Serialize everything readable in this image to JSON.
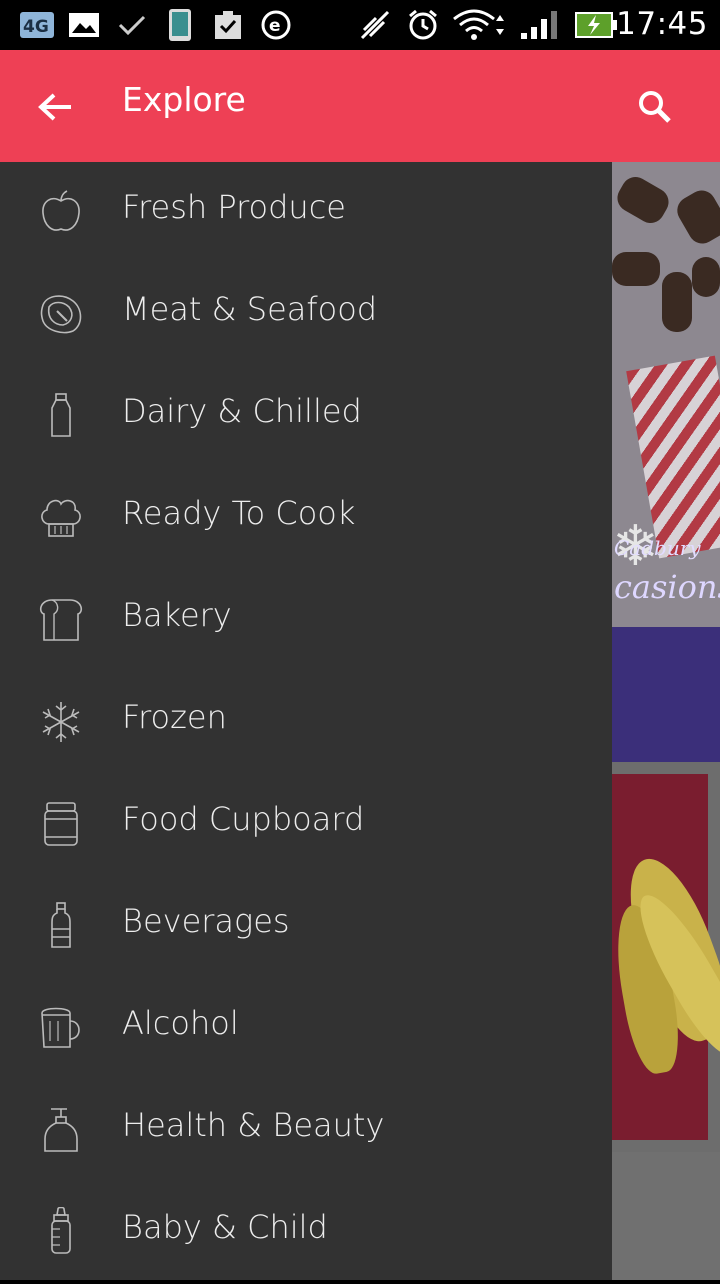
{
  "status_bar": {
    "time": "17:45",
    "icons": [
      "4g-lte-icon",
      "image-icon",
      "check-icon",
      "phone-icon",
      "clipboard-check-icon",
      "e-icon",
      "no-signal-icon",
      "alarm-icon",
      "wifi-icon",
      "cell-signal-icon",
      "battery-charging-icon"
    ]
  },
  "app_bar": {
    "title": "Explore",
    "back_icon": "arrow-back-icon",
    "search_icon": "search-icon",
    "color": "#ee4055"
  },
  "drawer": {
    "background": "#323232",
    "items": [
      {
        "label": "Fresh Produce",
        "icon": "apple-icon"
      },
      {
        "label": "Meat & Seafood",
        "icon": "steak-icon"
      },
      {
        "label": "Dairy & Chilled",
        "icon": "milk-bottle-icon"
      },
      {
        "label": "Ready To Cook",
        "icon": "chef-hat-icon"
      },
      {
        "label": "Bakery",
        "icon": "bread-icon"
      },
      {
        "label": "Frozen",
        "icon": "snowflake-icon"
      },
      {
        "label": "Food Cupboard",
        "icon": "jar-icon"
      },
      {
        "label": "Beverages",
        "icon": "bottle-icon"
      },
      {
        "label": "Alcohol",
        "icon": "beer-mug-icon"
      },
      {
        "label": "Health & Beauty",
        "icon": "lotion-pump-icon"
      },
      {
        "label": "Baby & Child",
        "icon": "baby-bottle-icon"
      }
    ]
  },
  "background_content": {
    "banner_brand": "Cadbury",
    "banner_text": "casions"
  }
}
